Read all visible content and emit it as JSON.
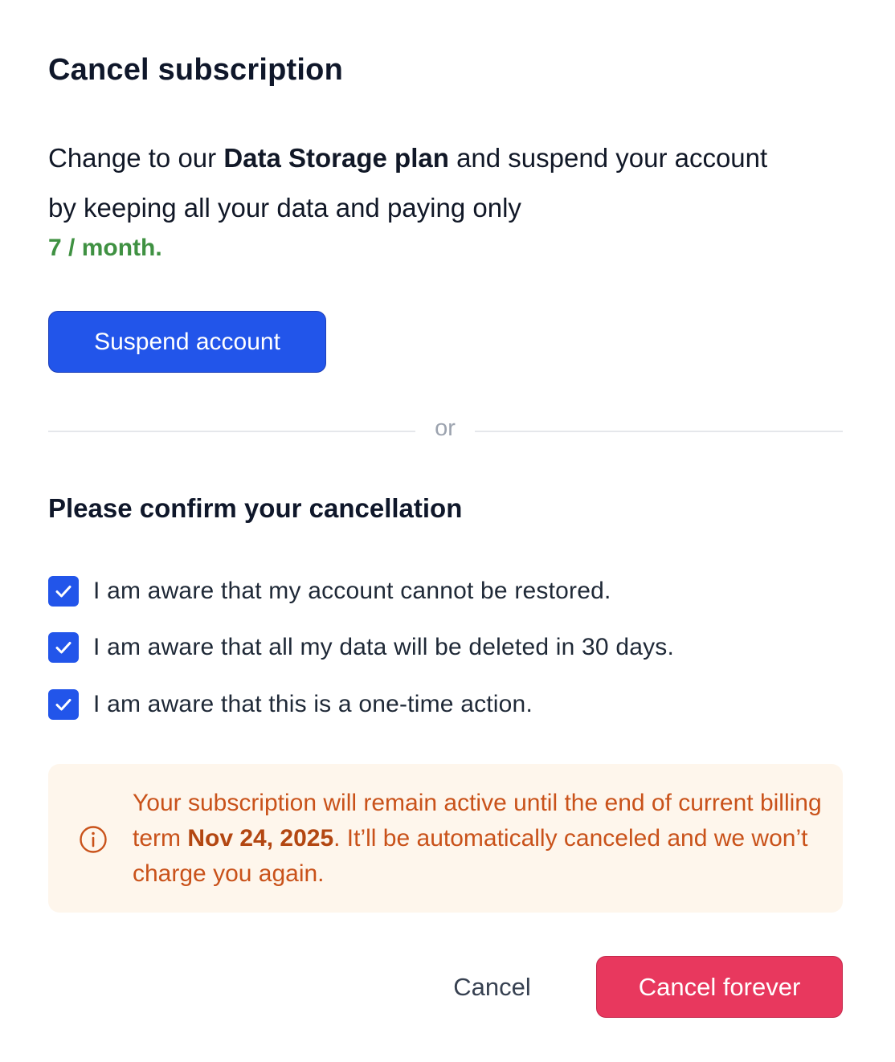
{
  "dialog": {
    "title": "Cancel subscription",
    "offer": {
      "text_before": "Change to our ",
      "plan_name": "Data Storage plan",
      "text_after": " and suspend your account by keeping all your data and paying only",
      "price": "7 / month."
    },
    "suspend_button": "Suspend account",
    "divider_text": "or",
    "confirm_title": "Please confirm your cancellation",
    "confirmations": [
      {
        "label": "I am aware that my account cannot be restored.",
        "checked": true
      },
      {
        "label": "I am aware that all my data will be deleted in 30 days.",
        "checked": true
      },
      {
        "label": "I am aware that this is a one-time action.",
        "checked": true
      }
    ],
    "notice": {
      "icon": "info-icon",
      "text_before": "Your subscription will remain active until the end of current billing term ",
      "date": "Nov 24, 2025",
      "text_after": ". It’ll be automatically canceled and we won’t charge you again."
    },
    "cancel_button": "Cancel",
    "cancel_forever_button": "Cancel forever"
  },
  "colors": {
    "primary": "#2255ea",
    "danger": "#e8385e",
    "price_green": "#3f9142",
    "notice_bg": "#fef6ec",
    "notice_text": "#c9521a"
  }
}
